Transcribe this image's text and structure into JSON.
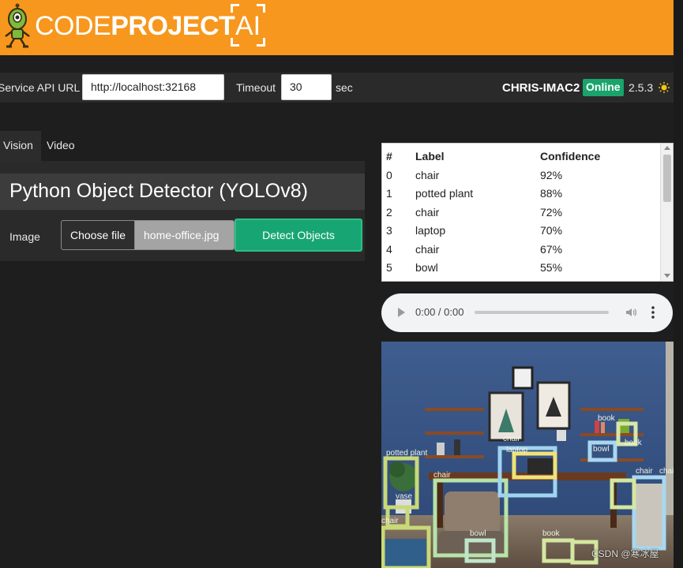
{
  "brand": {
    "code": "CODE",
    "project": "PROJECT",
    "ai": "AI"
  },
  "service_bar": {
    "api_url_label": "Service API URL",
    "api_url_value": "http://localhost:32168",
    "timeout_label": "Timeout",
    "timeout_value": "30",
    "timeout_unit": "sec",
    "host_name": "CHRIS-IMAC2",
    "status": "Online",
    "version": "2.5.3",
    "status_color": "#1aa36b"
  },
  "tabs": [
    {
      "label": "Vision",
      "active": true
    },
    {
      "label": "Video",
      "active": false
    }
  ],
  "module": {
    "title": "Python Object Detector (YOLOv8)",
    "image_label": "Image",
    "choose_file_label": "Choose file",
    "file_name": "home-office.jpg",
    "detect_button_label": "Detect Objects"
  },
  "results": {
    "headers": [
      "#",
      "Label",
      "Confidence"
    ],
    "rows": [
      {
        "idx": "0",
        "label": "chair",
        "confidence": "92%"
      },
      {
        "idx": "1",
        "label": "potted plant",
        "confidence": "88%"
      },
      {
        "idx": "2",
        "label": "chair",
        "confidence": "72%"
      },
      {
        "idx": "3",
        "label": "laptop",
        "confidence": "70%"
      },
      {
        "idx": "4",
        "label": "chair",
        "confidence": "67%"
      },
      {
        "idx": "5",
        "label": "bowl",
        "confidence": "55%"
      }
    ]
  },
  "audio": {
    "time": "0:00 / 0:00"
  },
  "detections": {
    "labels": [
      "potted plant",
      "chair",
      "chair",
      "laptop",
      "vase",
      "chair",
      "bowl",
      "book",
      "book",
      "bowl",
      "book",
      "chair",
      "chair"
    ]
  },
  "watermark": "CSDN @寒冰屋",
  "colors": {
    "header": "#f7971e",
    "accent_green": "#17a673",
    "background": "#1e1e1e"
  }
}
